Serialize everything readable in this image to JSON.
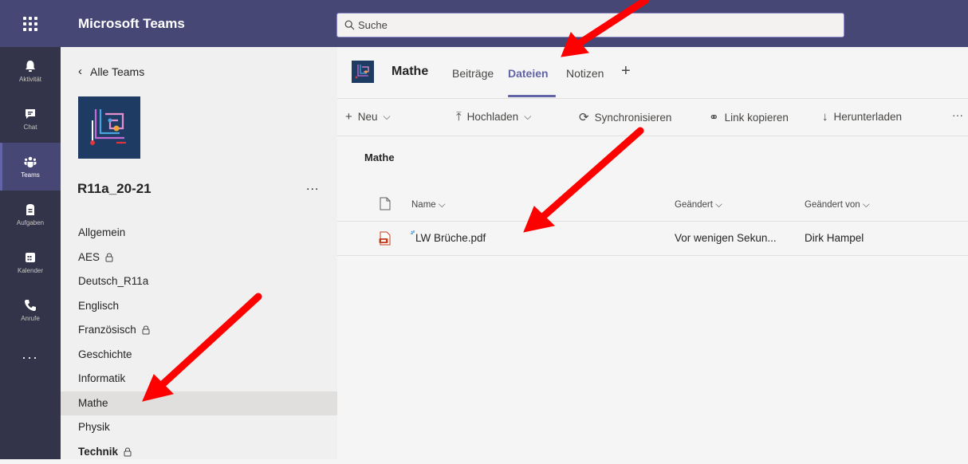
{
  "app": {
    "title": "Microsoft Teams"
  },
  "search": {
    "placeholder": "Suche"
  },
  "rail": [
    {
      "label": "Aktivität",
      "icon": "bell-icon"
    },
    {
      "label": "Chat",
      "icon": "chat-icon"
    },
    {
      "label": "Teams",
      "icon": "teams-icon",
      "active": true
    },
    {
      "label": "Aufgaben",
      "icon": "assignments-icon"
    },
    {
      "label": "Kalender",
      "icon": "calendar-icon"
    },
    {
      "label": "Anrufe",
      "icon": "phone-icon"
    }
  ],
  "rail_more": "...",
  "left": {
    "back_label": "Alle Teams",
    "team_name": "R11a_20-21",
    "more": "...",
    "channels": [
      {
        "name": "Allgemein"
      },
      {
        "name": "AES",
        "locked": true
      },
      {
        "name": "Deutsch_R11a"
      },
      {
        "name": "Englisch"
      },
      {
        "name": "Französisch",
        "locked": true
      },
      {
        "name": "Geschichte"
      },
      {
        "name": "Informatik"
      },
      {
        "name": "Mathe",
        "selected": true
      },
      {
        "name": "Physik"
      },
      {
        "name": "Technik",
        "locked": true,
        "bold": true
      }
    ]
  },
  "channel": {
    "title": "Mathe",
    "tabs": [
      "Beiträge",
      "Dateien",
      "Notizen"
    ],
    "active_tab": "Dateien",
    "add": "+"
  },
  "toolbar": {
    "new": "Neu",
    "upload": "Hochladen",
    "sync": "Synchronisieren",
    "copy_link": "Link kopieren",
    "download": "Herunterladen",
    "more": "···"
  },
  "files": {
    "folder": "Mathe",
    "columns": {
      "name": "Name",
      "modified": "Geändert",
      "modified_by": "Geändert von"
    },
    "rows": [
      {
        "name": "LW Brüche.pdf",
        "modified": "Vor wenigen Sekun...",
        "modified_by": "Dirk Hampel",
        "type": "pdf"
      }
    ]
  },
  "colors": {
    "topbar": "#464775",
    "rail": "#33344a",
    "accent": "#6264a7",
    "arrow": "#ff0000"
  }
}
